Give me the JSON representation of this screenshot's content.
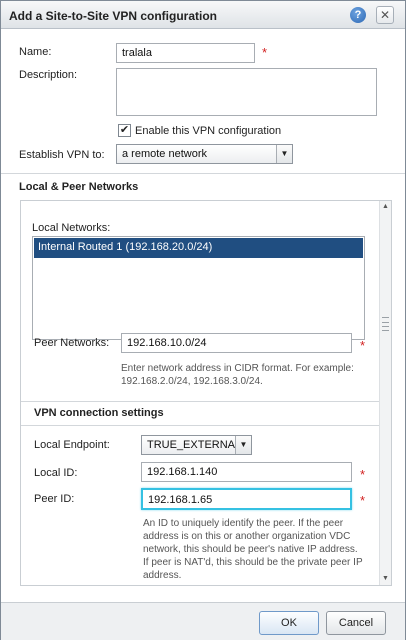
{
  "dialog": {
    "title": "Add a Site-to-Site VPN configuration",
    "help_glyph": "?",
    "close_glyph": "✕"
  },
  "form": {
    "name_label": "Name:",
    "name_value": "tralala",
    "description_label": "Description:",
    "description_value": "",
    "enable_checked": true,
    "enable_label": "Enable this VPN configuration",
    "establish_label": "Establish VPN to:",
    "establish_value": "a remote network"
  },
  "networks": {
    "section_title": "Local & Peer Networks",
    "local_label": "Local Networks:",
    "local_items": [
      "Internal Routed 1 (192.168.20.0/24)"
    ],
    "peer_label": "Peer Networks:",
    "peer_value": "192.168.10.0/24",
    "peer_hint": "Enter network address in CIDR format. For example: 192.168.2.0/24, 192.168.3.0/24."
  },
  "vpn_settings": {
    "section_title": "VPN connection settings",
    "local_endpoint_label": "Local Endpoint:",
    "local_endpoint_value": "TRUE_EXTERNAL",
    "local_id_label": "Local ID:",
    "local_id_value": "192.168.1.140",
    "peer_id_label": "Peer ID:",
    "peer_id_value": "192.168.1.65",
    "peer_id_hint": "An ID to uniquely identify the peer. If the peer address is on this or another organization VDC network, this should be peer's native IP address. If peer is NAT'd, this should be the private peer IP address."
  },
  "required_marker": "*",
  "buttons": {
    "ok": "OK",
    "cancel": "Cancel"
  }
}
